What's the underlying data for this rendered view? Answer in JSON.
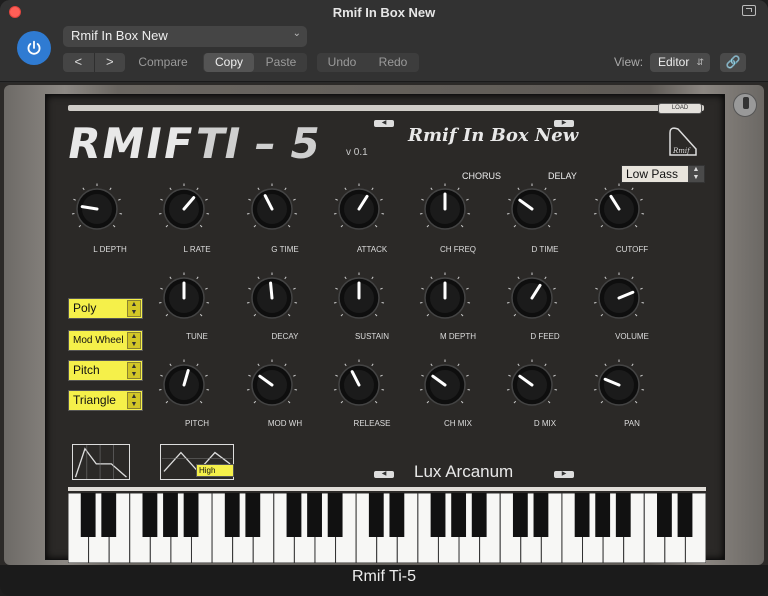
{
  "window": {
    "title": "Rmif In Box New"
  },
  "toolbar": {
    "preset": "Rmif In Box New",
    "back": "<",
    "forward": ">",
    "compare": "Compare",
    "copy": "Copy",
    "paste": "Paste",
    "undo": "Undo",
    "redo": "Redo",
    "view_label": "View:",
    "view_value": "Editor"
  },
  "plugin": {
    "brand": "RMIF",
    "model": "TI – 5",
    "version": "v 0.1",
    "preset_script": "Rmif In Box New",
    "piano_logo_text": "Rmif",
    "load": "LOAD",
    "sections": {
      "chorus": "CHORUS",
      "delay": "DELAY"
    },
    "filter_select": "Low Pass",
    "selects": [
      {
        "label": "Poly"
      },
      {
        "label": "Mod Wheel"
      },
      {
        "label": "Pitch"
      },
      {
        "label": "Triangle"
      }
    ],
    "lfo_range": "High",
    "knobs": [
      {
        "label": "L DEPTH",
        "pos": 0.2
      },
      {
        "label": "L RATE",
        "pos": 0.65
      },
      {
        "label": "G TIME",
        "pos": 0.4
      },
      {
        "label": "ATTACK",
        "pos": 0.62
      },
      {
        "label": "CH FREQ",
        "pos": 0.5
      },
      {
        "label": "D TIME",
        "pos": 0.3
      },
      {
        "label": "CUTOFF",
        "pos": 0.38
      },
      {
        "label": "TUNE",
        "pos": 0.5
      },
      {
        "label": "DECAY",
        "pos": 0.48
      },
      {
        "label": "SUSTAIN",
        "pos": 0.5
      },
      {
        "label": "M DEPTH",
        "pos": 0.5
      },
      {
        "label": "D FEED",
        "pos": 0.62
      },
      {
        "label": "VOLUME",
        "pos": 0.75
      },
      {
        "label": "PITCH",
        "pos": 0.56
      },
      {
        "label": "MOD WH",
        "pos": 0.3
      },
      {
        "label": "RELEASE",
        "pos": 0.4
      },
      {
        "label": "CH MIX",
        "pos": 0.3
      },
      {
        "label": "D MIX",
        "pos": 0.3
      },
      {
        "label": "PAN",
        "pos": 0.25
      }
    ],
    "patch_name": "Lux Arcanum",
    "footer": "Rmif Ti-5"
  }
}
